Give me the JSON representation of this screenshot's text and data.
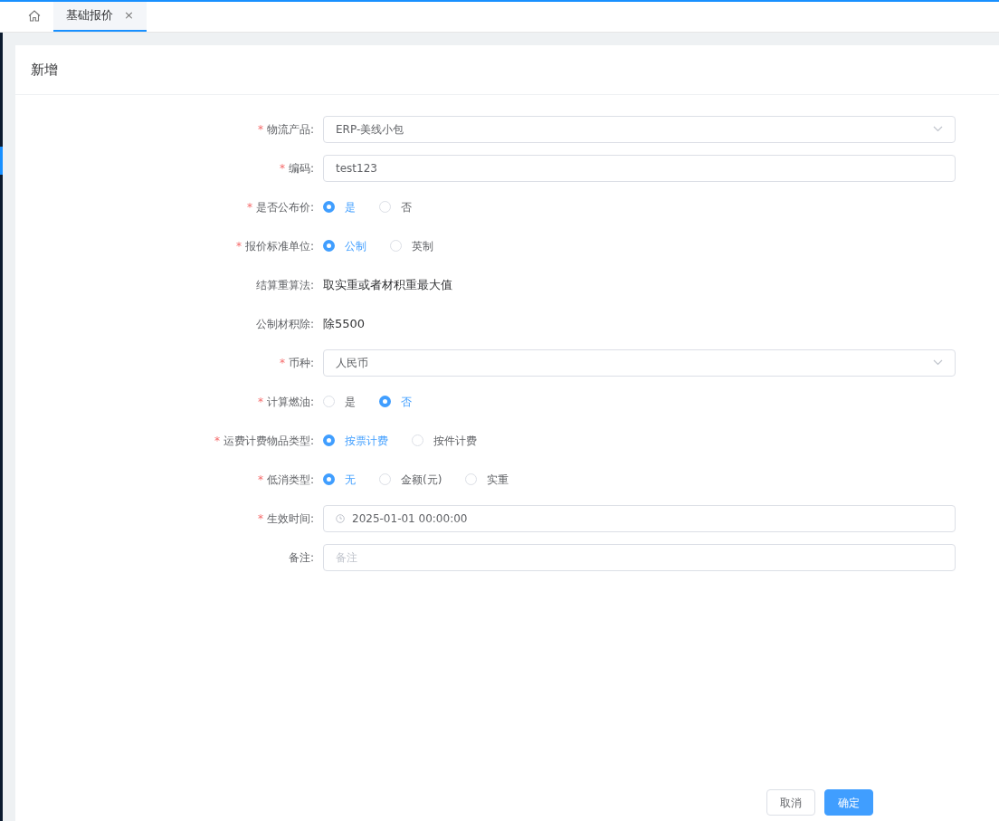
{
  "tabs": [
    {
      "kind": "home",
      "selected": false
    },
    {
      "kind": "page",
      "label": "基础报价",
      "selected": true,
      "close": "×"
    }
  ],
  "dialog": {
    "title": "新增",
    "fields": [
      {
        "kind": "select",
        "marker": "*",
        "label": "物流产品:",
        "value": "ERP-美线小包"
      },
      {
        "kind": "input",
        "marker": "*",
        "label": "编码:",
        "value": "test123"
      },
      {
        "kind": "radio",
        "marker": "*",
        "label": "是否公布价:",
        "options": [
          {
            "label": "是",
            "selected": true
          },
          {
            "label": "否",
            "selected": false
          }
        ]
      },
      {
        "kind": "radio",
        "marker": "*",
        "label": "报价标准单位:",
        "options": [
          {
            "label": "公制",
            "selected": true
          },
          {
            "label": "英制",
            "selected": false
          }
        ]
      },
      {
        "kind": "text",
        "label": "结算重算法:",
        "value": "取实重或者材积重最大值"
      },
      {
        "kind": "text",
        "label": "公制材积除:",
        "value": "除5500"
      },
      {
        "kind": "select",
        "marker": "*",
        "label": "币种:",
        "value": "人民币"
      },
      {
        "kind": "radio",
        "marker": "*",
        "label": "计算燃油:",
        "options": [
          {
            "label": "是",
            "selected": false
          },
          {
            "label": "否",
            "selected": true
          }
        ]
      },
      {
        "kind": "radio",
        "marker": "*",
        "label": "运费计费物品类型:",
        "options": [
          {
            "label": "按票计费",
            "selected": true
          },
          {
            "label": "按件计费",
            "selected": false
          }
        ]
      },
      {
        "kind": "radio",
        "marker": "*",
        "label": "低消类型:",
        "options": [
          {
            "label": "无",
            "selected": true
          },
          {
            "label": "金额(元)",
            "selected": false
          },
          {
            "label": "实重",
            "selected": false
          }
        ]
      },
      {
        "kind": "date",
        "marker": "*",
        "label": "生效时间:",
        "value": "2025-01-01 00:00:00"
      },
      {
        "kind": "input",
        "label": "备注:",
        "placeholder": "备注"
      }
    ],
    "buttons": [
      {
        "kind": "default",
        "label": "取消"
      },
      {
        "kind": "primary",
        "label": "确定"
      }
    ]
  }
}
